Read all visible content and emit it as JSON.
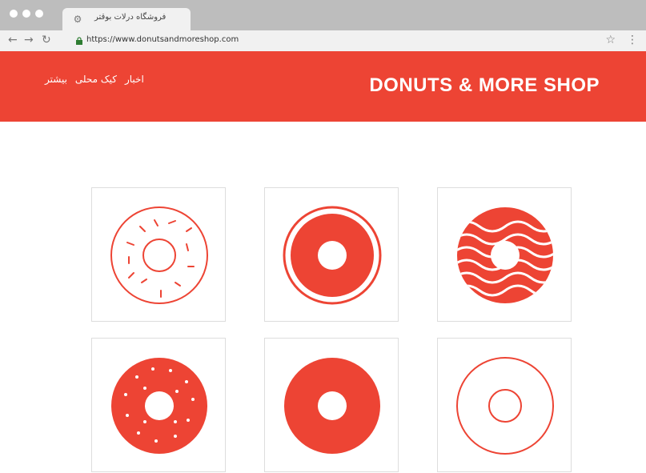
{
  "browser": {
    "tab_title": "فروشگاه درلات بوقتر",
    "tab_icon": "gear-icon",
    "url": "https://www.donutsandmoreshop.com",
    "nav_icons": [
      "back-arrow-icon",
      "forward-arrow-icon",
      "reload-icon"
    ],
    "right_icons": [
      "bookmark-star-icon",
      "more-menu-icon"
    ]
  },
  "site": {
    "brand_text": "DONUTS & MORE SHOP",
    "nav": [
      "اخبار",
      "کیک محلی",
      "بیشتر"
    ],
    "accent_color": "#ed4434"
  },
  "products": [
    {
      "name": "donut-sprinkled-outline",
      "style": "outline-sprinkles"
    },
    {
      "name": "donut-filled-ring",
      "style": "solid-with-ring"
    },
    {
      "name": "donut-wavy",
      "style": "solid-wavy"
    },
    {
      "name": "donut-dotted",
      "style": "solid-dots"
    },
    {
      "name": "donut-solid",
      "style": "solid"
    },
    {
      "name": "donut-thin-outline",
      "style": "outline-thin"
    }
  ]
}
